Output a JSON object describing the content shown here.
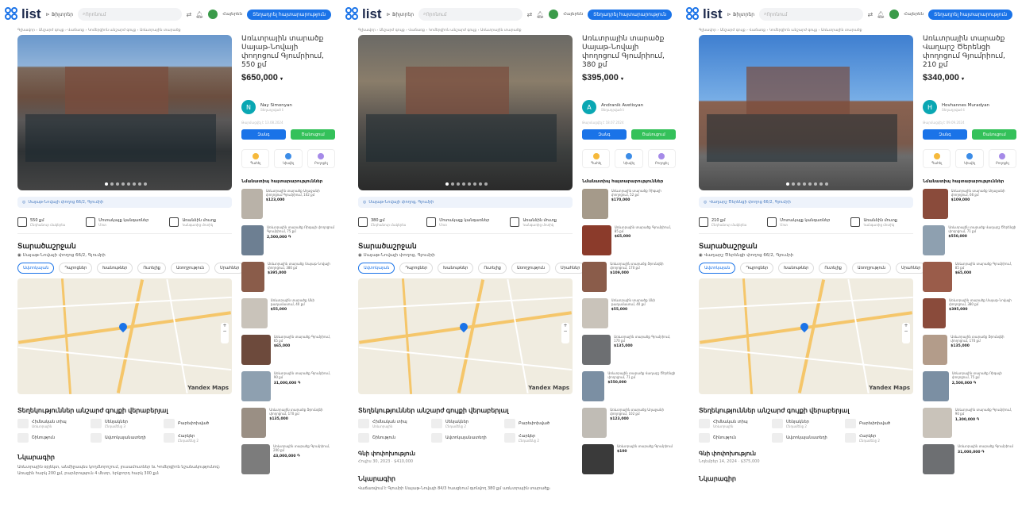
{
  "header": {
    "logo": "list",
    "filters_label": "Ֆիլտրեր",
    "search_placeholder": "Որոնում",
    "lang": "Հայերեն",
    "post_button": "Տեղադրել հայտարարություն"
  },
  "colors": {
    "accent": "#1a73e8",
    "green": "#34c15a"
  },
  "panels": [
    {
      "breadcrumbs": "Գլխավոր › Անշարժ գույք › Վաճառք › Կոմերցիոն անշարժ գույք › Առևտրային տարածք",
      "title": "Առևտրային տարածք Սայաթ-Նովայի փողոցում Գյումրիում, 550 քմ",
      "price": "$650,000",
      "seller_initial": "N",
      "seller_name": "Nay Simonyan",
      "seller_sub": "Տեղադրված է",
      "meta": "Թարմացվել է 13.08.2024",
      "call_label": "Զանգ",
      "message_label": "Ծանուցում",
      "actions": [
        "Պահել",
        "Կիսվել",
        "Բողոքել"
      ],
      "address": "Սայաթ-Նովայի փողոց 66/2, Գյումրի",
      "features": [
        {
          "title": "550 քմ",
          "sub": "Ընդհանուր մակերես"
        },
        {
          "title": "Մոտակայք կանգառներ",
          "sub": "Մոտ"
        },
        {
          "title": "Առանձին մուտք",
          "sub": "Կանգառից մոտիկ"
        }
      ],
      "location_title": "Տարածաշրջան",
      "location_line": "Սայաթ-Նովայի փողոց 66/2, Գյումրի",
      "tabs": [
        "Ավտոկայան",
        "Դպրոցներ",
        "Խանութներ",
        "Ուտելիք",
        "Առողջություն",
        "Սրահներ"
      ],
      "map_brand": "Yandex Maps",
      "places_title": "Տեղեկություններ անշարժ գույքի վերաբերյալ",
      "places": [
        {
          "t": "Հիմնական տիպ",
          "s": "Առևտրային"
        },
        {
          "t": "Սենյակներ",
          "s": "Ընդամենը 3"
        },
        {
          "t": "Բարեփոխված",
          "s": ""
        },
        {
          "t": "Շինություն",
          "s": ""
        },
        {
          "t": "Ավտոկայանատեղի",
          "s": ""
        },
        {
          "t": "Հարկեր",
          "s": "Ընդամենը 2"
        }
      ],
      "price_history_title": "",
      "price_history_date": "",
      "desc_title": "Նկարագիր",
      "desc": "Առևտրային օբյեկտ, անմիջապես կողմնորոշում, լուսամուտներ եւ Կոմերցիոն նշանակությունով։ Առաջին հարկ 200 քմ, բարձրություն 4 մետր, երկրորդ հարկ 300 քմ։",
      "similar_title": "Նմանատիպ հայտարարություններ",
      "similar": [
        {
          "text": "Առևտրային տարածք Աղաջանի փողոցում Գյումրիում, 102 քմ",
          "price": "$123,000"
        },
        {
          "text": "Առևտրային տարածք Ռիգայի փողոցում Գյումրիում, 75 քմ",
          "price": "2,500,000 ֏"
        },
        {
          "text": "Առևտրային տարածք Սայաթ-Նովայի փողոցում, 380 քմ",
          "price": "$395,000"
        },
        {
          "text": "Առևտրային տարածք Անի թաղամասում, 40 քմ",
          "price": "$55,000"
        },
        {
          "text": "Առևտրային տարածք Գյումրիում, 65 քմ",
          "price": "$65,000"
        },
        {
          "text": "Առևտրային տարածք Գյումրիում, 90 քմ",
          "price": "31,000,000 ֏"
        },
        {
          "text": "Առևտրային տարածք Ֆրունզեի փողոցում, 170 քմ",
          "price": "$135,000"
        },
        {
          "text": "Առևտրային տարածք Գյումրիում, 200 քմ",
          "price": "43,000,000 ֏"
        }
      ]
    },
    {
      "breadcrumbs": "Գլխավոր › Անշարժ գույք › Վաճառք › Կոմերցիոն անշարժ գույք › Առևտրային տարածք",
      "title": "Առևտրային տարածք Սայաթ-Նովայի փողոցում Գյումրիում, 380 քմ",
      "price": "$395,000",
      "seller_initial": "A",
      "seller_name": "Andranik Avetisyan",
      "seller_sub": "Տեղադրված է",
      "meta": "Թարմացվել է 18.07.2024",
      "call_label": "Զանգ",
      "message_label": "Ծանուցում",
      "actions": [
        "Պահել",
        "Կիսվել",
        "Բողոքել"
      ],
      "address": "Սայաթ-Նովայի փողոց, Գյումրի",
      "features": [
        {
          "title": "380 քմ",
          "sub": "Ընդհանուր մակերես"
        },
        {
          "title": "Մոտակայք կանգառներ",
          "sub": "Մոտ"
        },
        {
          "title": "Առանձին մուտք",
          "sub": "Կանգառից մոտիկ"
        }
      ],
      "location_title": "Տարածաշրջան",
      "location_line": "Սայաթ-Նովայի փողոց, Գյումրի",
      "tabs": [
        "Ավտոկայան",
        "Դպրոցներ",
        "Խանութներ",
        "Ուտելիք",
        "Առողջություն",
        "Սրահներ"
      ],
      "map_brand": "Yandex Maps",
      "places_title": "Տեղեկություններ անշարժ գույքի վերաբերյալ",
      "places": [
        {
          "t": "Հիմնական տիպ",
          "s": "Առևտրային"
        },
        {
          "t": "Սենյակներ",
          "s": "Ընդամենը 2"
        },
        {
          "t": "Բարեփոխված",
          "s": ""
        },
        {
          "t": "Շինություն",
          "s": ""
        },
        {
          "t": "Ավտոկայանատեղի",
          "s": ""
        },
        {
          "t": "Հարկեր",
          "s": "Ընդամենը 2"
        }
      ],
      "price_history_title": "Գնի փոփոխություն",
      "price_history_date": "Հուլիս 30, 2023 · $410,000",
      "desc_title": "Նկարագիր",
      "desc": "Վաճառվում է Գյումրի Սայաթ-Նովայի 84/3 հասցեում գտնվող 380 քմ առևտրային տարածք։",
      "similar_title": "Նմանատիպ հայտարարություններ",
      "similar": [
        {
          "text": "Առևտրային տարածք Ռիգայի փողոցում, 52 քմ",
          "price": "$170,000"
        },
        {
          "text": "Առևտրային տարածք Գյումրիում, 85 քմ",
          "price": "$65,000"
        },
        {
          "text": "Առևտրային տարածք Ֆրունզեի փողոցում, 170 քմ",
          "price": "$109,000"
        },
        {
          "text": "Առևտրային տարածք Անի թաղամասում, 40 քմ",
          "price": "$55,000"
        },
        {
          "text": "Առևտրային տարածք Գյումրիում, 170 քմ",
          "price": "$135,000"
        },
        {
          "text": "Առևտրային տարածք Վաղարշ Ծերենցի փողոցում, 71 քմ",
          "price": "$550,000"
        },
        {
          "text": "Առևտրային տարածք Աղաջանի փողոցում, 102 քմ",
          "price": "$123,000"
        },
        {
          "text": "Առևտրային տարածք Գյումրիում",
          "price": "$100"
        }
      ]
    },
    {
      "breadcrumbs": "Գլխավոր › Անշարժ գույք › Վաճառք › Կոմերցիոն անշարժ գույք › Առևտրային տարածք",
      "title": "Առևտրային տարածք Վաղարշ Ծերենցի փողոցում Գյումրիում, 210 քմ",
      "price": "$340,000",
      "seller_initial": "H",
      "seller_name": "Hovhannes Muradyan",
      "seller_sub": "Տեղադրված է",
      "meta": "Թարմացվել է 09.09.2024",
      "call_label": "Զանգ",
      "message_label": "Ծանուցում",
      "actions": [
        "Պահել",
        "Կիսվել",
        "Բողոքել"
      ],
      "address": "Վաղարշ Ծերենցի փողոց 66/2, Գյումրի",
      "features": [
        {
          "title": "210 քմ",
          "sub": "Ընդհանուր մակերես"
        },
        {
          "title": "Մոտակայք կանգառներ",
          "sub": "Մոտ"
        },
        {
          "title": "Առանձին մուտք",
          "sub": "Կանգառից մոտիկ"
        }
      ],
      "location_title": "Տարածաշրջան",
      "location_line": "Վաղարշ Ծերենցի փողոց 66/2, Գյումրի",
      "tabs": [
        "Ավտոկայան",
        "Դպրոցներ",
        "Խանութներ",
        "Ուտելիք",
        "Առողջություն",
        "Սրահներ"
      ],
      "map_brand": "Yandex Maps",
      "places_title": "Տեղեկություններ անշարժ գույքի վերաբերյալ",
      "places": [
        {
          "t": "Հիմնական տիպ",
          "s": "Առևտրային"
        },
        {
          "t": "Սենյակներ",
          "s": "Ընդամենը 2"
        },
        {
          "t": "Բարեփոխված",
          "s": ""
        },
        {
          "t": "Շինություն",
          "s": ""
        },
        {
          "t": "Ավտոկայանատեղի",
          "s": ""
        },
        {
          "t": "Հարկեր",
          "s": "Ընդամենը 2"
        }
      ],
      "price_history_title": "Գնի փոփոխություն",
      "price_history_date": "Նոյեմբեր 14, 2024 · $375,000",
      "desc_title": "Նկարագիր",
      "desc": "",
      "similar_title": "Նմանատիպ հայտարարություններ",
      "similar": [
        {
          "text": "Առևտրային տարածք Աղաջանի փողոցում, 66 քմ",
          "price": "$109,000"
        },
        {
          "text": "Առևտրային տարածք Վաղարշ Ծերենցի փողոցում, 71 քմ",
          "price": "$550,000"
        },
        {
          "text": "Առևտրային տարածք Գյումրիում, 85 քմ",
          "price": "$65,000"
        },
        {
          "text": "Առևտրային տարածք Սայաթ-Նովայի փողոցում, 380 քմ",
          "price": "$395,000"
        },
        {
          "text": "Առևտրային տարածք Ֆրունզեի փողոցում, 170 քմ",
          "price": "$135,000"
        },
        {
          "text": "Առևտրային տարածք Ռիգայի փողոցում, 75 քմ",
          "price": "2,500,000 ֏"
        },
        {
          "text": "Առևտրային տարածք Գյումրիում, 90 քմ",
          "price": "1,300,000 ֏"
        },
        {
          "text": "Առևտրային տարածք Գյումրիում",
          "price": "31,000,000 ֏"
        }
      ]
    }
  ]
}
